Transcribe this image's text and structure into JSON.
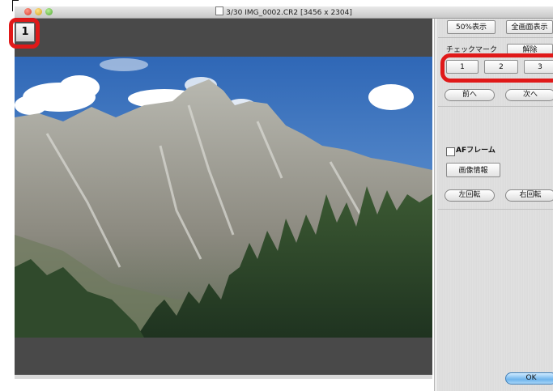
{
  "window": {
    "title": "3/30 IMG_0002.CR2 [3456 x 2304]"
  },
  "viewer": {
    "check_badge": "1"
  },
  "panel": {
    "zoom_50_label": "50%表示",
    "fit_screen_label": "全画面表示",
    "check_mark_label": "チェックマーク",
    "release_label": "解除",
    "check_buttons": [
      "1",
      "2",
      "3"
    ],
    "prev_label": "前へ",
    "next_label": "次へ",
    "af_frame_label": "AFフレーム",
    "af_frame_checked": false,
    "image_info_label": "画像情報",
    "rotate_left_label": "左回転",
    "rotate_right_label": "右回転",
    "ok_label": "OK"
  },
  "colors": {
    "highlight_ring": "#e01919",
    "viewer_background": "#494949",
    "ok_button": "#6fb4ec"
  },
  "icons": {
    "window_controls": [
      "close-icon",
      "minimize-icon",
      "zoom-icon"
    ],
    "title_icon": "document-icon"
  }
}
